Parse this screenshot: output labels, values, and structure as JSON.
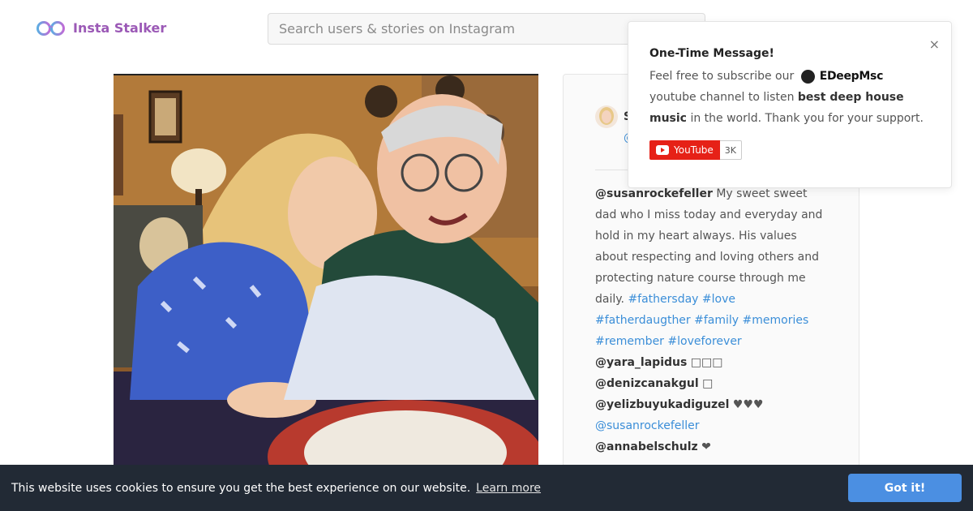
{
  "header": {
    "brand": "Insta Stalker",
    "search_placeholder": "Search users & stories on Instagram"
  },
  "post": {
    "user_partial": "S",
    "handle_partial": "@",
    "caption_user": "@susanrockefeller",
    "caption_text": "My sweet sweet dad who I miss today and everyday and hold in my heart always. His values about respecting and loving others and protecting nature course through me daily.",
    "hashtags": [
      "#fathersday",
      "#love",
      "#fatherdaugther",
      "#family",
      "#memories",
      "#remember",
      "#loveforever"
    ],
    "comments": [
      {
        "user": "@yara_lapidus",
        "text": "□□□"
      },
      {
        "user": "@denizcanakgul",
        "text": "□"
      },
      {
        "user": "@yelizbuyukadiguzel",
        "text": "♥♥♥"
      },
      {
        "user": "",
        "text": "@susanrockefeller"
      },
      {
        "user": "@annabelschulz",
        "text": "❤"
      }
    ]
  },
  "popup": {
    "title": "One-Time Message!",
    "text_1": "Feel free to subscribe our",
    "brand": "EDeepMsc",
    "text_2": "youtube channel to listen",
    "text_bold": "best deep house music",
    "text_3": "in the world. Thank you for your support.",
    "close": "×",
    "youtube_label": "YouTube",
    "youtube_count": "3K"
  },
  "cookie": {
    "message": "This website uses cookies to ensure you get the best experience on our website.",
    "learn_more": "Learn more",
    "accept": "Got it!"
  },
  "colors": {
    "brand": "#9b59b6",
    "link": "#3b8ed8",
    "cookie_bg": "#222a35",
    "cookie_button": "#4b8fe2",
    "youtube_red": "#e62117"
  }
}
